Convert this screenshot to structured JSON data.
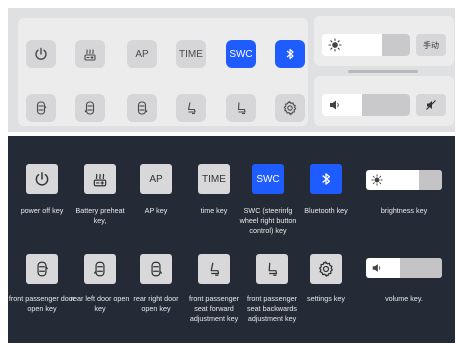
{
  "top_panel": {
    "keys": [
      {
        "id": "power",
        "icon": "power-icon",
        "label": ""
      },
      {
        "id": "battery",
        "icon": "battery-heat-icon",
        "label": ""
      },
      {
        "id": "ap",
        "icon": "",
        "label": "AP"
      },
      {
        "id": "time",
        "icon": "",
        "label": "TIME"
      },
      {
        "id": "swc",
        "icon": "",
        "label": "SWC",
        "active": true
      },
      {
        "id": "bluetooth",
        "icon": "bluetooth-icon",
        "label": "",
        "active": true
      },
      {
        "id": "fp-door",
        "icon": "car-door-icon",
        "label": ""
      },
      {
        "id": "rl-door",
        "icon": "car-door-icon",
        "label": ""
      },
      {
        "id": "rr-door",
        "icon": "car-door-icon",
        "label": ""
      },
      {
        "id": "seat-fwd",
        "icon": "seat-icon",
        "label": ""
      },
      {
        "id": "seat-back",
        "icon": "seat-icon",
        "label": ""
      },
      {
        "id": "settings",
        "icon": "gear-icon",
        "label": ""
      }
    ],
    "brightness": {
      "level": 0.68,
      "mode_label": "手动",
      "icon": "sun-icon"
    },
    "volume": {
      "level": 0.45,
      "icon": "speaker-icon",
      "mute_icon": "mute-icon"
    }
  },
  "legend": {
    "row1": [
      {
        "label": "power off key"
      },
      {
        "label": "Battery preheat key,"
      },
      {
        "key_text": "AP",
        "label": "AP key"
      },
      {
        "key_text": "TIME",
        "label": "time key"
      },
      {
        "key_text": "SWC",
        "label": "SWC (steerinfg wheel right button control) key"
      },
      {
        "label": "Bluetooth key"
      },
      {
        "label": "brightness key"
      }
    ],
    "row2": [
      {
        "label": "front passenger door open key"
      },
      {
        "label": "rear left door open key"
      },
      {
        "label": "rear right door open key"
      },
      {
        "label": "front passenger seat forward adjustment key"
      },
      {
        "label": "front passenger seat backwards adjustment key"
      },
      {
        "label": "settings key"
      },
      {
        "label": "volume key."
      }
    ],
    "brightness_level": 0.7,
    "volume_level": 0.45
  },
  "colors": {
    "accent": "#1f5cff",
    "dark_bg": "#252b36",
    "light_bg": "#ececed"
  }
}
